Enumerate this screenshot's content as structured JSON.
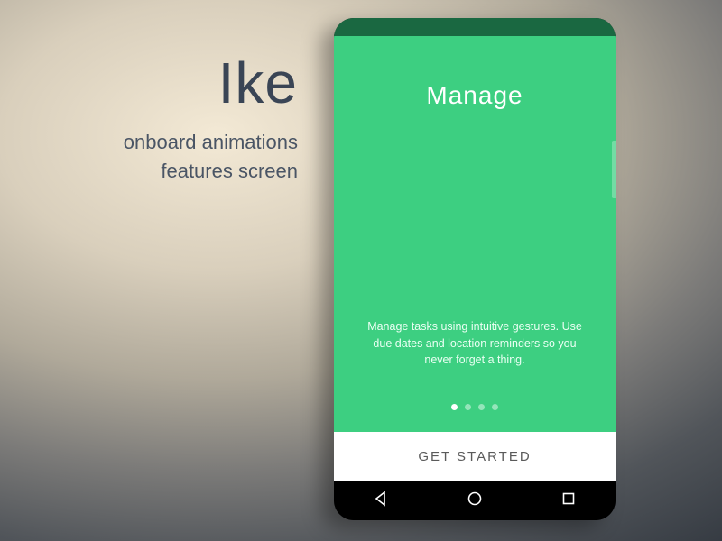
{
  "marketing": {
    "app_name": "Ike",
    "subline_1": "onboard animations",
    "subline_2": "features screen"
  },
  "onboarding": {
    "title": "Manage",
    "description": "Manage tasks using intuitive gestures. Use due dates and location reminders so you never forget a thing.",
    "cta_label": "GET STARTED",
    "page_count": 4,
    "current_page": 1
  },
  "colors": {
    "screen_bg": "#3dcf81",
    "statusbar": "#1a6841",
    "cta_bg": "#ffffff",
    "cta_text": "#5a5a5a"
  }
}
